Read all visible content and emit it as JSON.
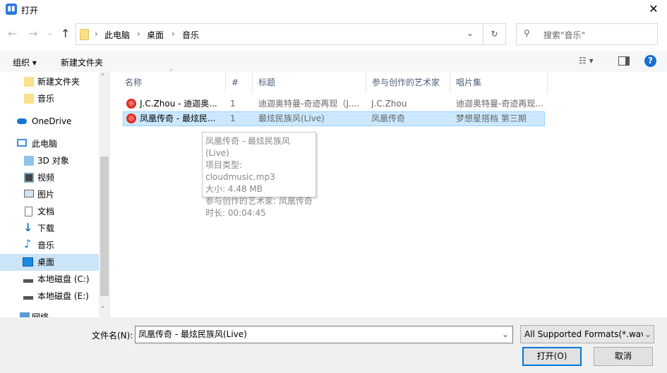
{
  "window": {
    "title": "打开",
    "close": "✕"
  },
  "nav": {
    "back": "←",
    "forward": "→",
    "recent": "⌄",
    "up": "↑",
    "breadcrumb": [
      "此电脑",
      "桌面",
      "音乐"
    ],
    "refresh": "↻",
    "dropdown": "⌄",
    "search_placeholder": "搜索\"音乐\""
  },
  "toolbar": {
    "organize": "组织 ▾",
    "new_folder": "新建文件夹",
    "help": "?"
  },
  "sidebar": {
    "items": [
      {
        "label": "新建文件夹",
        "icon": "folder-icon"
      },
      {
        "label": "音乐",
        "icon": "folder-icon"
      },
      {
        "label": "OneDrive",
        "icon": "cloud-icon"
      },
      {
        "label": "此电脑",
        "icon": "computer-icon"
      },
      {
        "label": "3D 对象",
        "icon": "cube-icon"
      },
      {
        "label": "视频",
        "icon": "video-icon"
      },
      {
        "label": "图片",
        "icon": "picture-icon"
      },
      {
        "label": "文档",
        "icon": "document-icon"
      },
      {
        "label": "下载",
        "icon": "download-icon"
      },
      {
        "label": "音乐",
        "icon": "music-icon"
      },
      {
        "label": "桌面",
        "icon": "desktop-icon"
      },
      {
        "label": "本地磁盘 (C:)",
        "icon": "drive-icon"
      },
      {
        "label": "本地磁盘 (E:)",
        "icon": "drive-icon"
      },
      {
        "label": "网络",
        "icon": "network-icon"
      }
    ]
  },
  "columns": [
    "名称",
    "#",
    "标题",
    "参与创作的艺术家",
    "唱片集"
  ],
  "files": [
    {
      "name": "J.C.Zhou - 迪迦奥...",
      "num": "1",
      "title": "迪迦奥特曼-奇迹再现（J....",
      "artist": "J.C.Zhou",
      "album": "迪迦奥特曼-奇迹再现..."
    },
    {
      "name": "凤凰传奇 - 最炫民...",
      "num": "1",
      "title": "最炫民族风(Live)",
      "artist": "凤凰传奇",
      "album": "梦想星搭档 第三期"
    }
  ],
  "tooltip": [
    "凤凰传奇 - 最炫民族风(Live)",
    "项目类型: cloudmusic.mp3",
    "大小: 4.48 MB",
    "参与创作的艺术家: 凤凰传奇",
    "时长: 00:04:45"
  ],
  "footer": {
    "filename_label": "文件名(N):",
    "filename_value": "凤凰传奇 - 最炫民族风(Live)",
    "filetype": "All Supported Formats(*.wav",
    "open": "打开(O)",
    "cancel": "取消"
  }
}
